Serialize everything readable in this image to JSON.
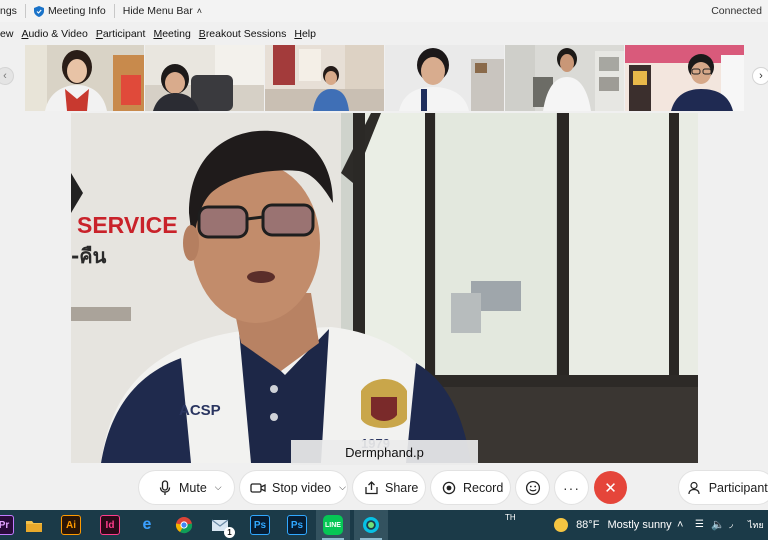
{
  "topbar": {
    "settings_fragment": "ngs",
    "meeting_info": "Meeting Info",
    "hide_menu_bar": "Hide Menu Bar",
    "status": "Connected"
  },
  "menubar": {
    "items": [
      {
        "before": "",
        "accel": "",
        "after": "ew"
      },
      {
        "before": "",
        "accel": "A",
        "after": "udio & Video"
      },
      {
        "before": "",
        "accel": "P",
        "after": "articipant"
      },
      {
        "before": "",
        "accel": "M",
        "after": "eeting"
      },
      {
        "before": "",
        "accel": "B",
        "after": "reakout Sessions"
      },
      {
        "before": "",
        "accel": "H",
        "after": "elp"
      }
    ]
  },
  "main_video": {
    "name_label": "Dermphand.p",
    "wall_text": "SERVICE",
    "wall_text_2": "-คืน",
    "shirt_text": "ACSP",
    "crest_year": "1979"
  },
  "controls": {
    "mute": "Mute",
    "stop_video": "Stop video",
    "share": "Share",
    "record": "Record",
    "participants": "Participants"
  },
  "taskbar": {
    "input_lang": "TH",
    "temperature": "88°F",
    "weather": "Mostly sunny",
    "ime_lang": "ไทย",
    "icons": [
      "premiere-icon",
      "file-explorer-icon",
      "illustrator-icon",
      "indesign-icon",
      "edge-icon",
      "chrome-icon",
      "mail-icon",
      "photoshop-icon",
      "photoshop-icon-2",
      "line-icon",
      "webex-icon"
    ],
    "mail_badge": "1"
  },
  "colors": {
    "end_button": "#e5453a",
    "taskbar": "#1b3a48",
    "service_red": "#c9222a"
  }
}
